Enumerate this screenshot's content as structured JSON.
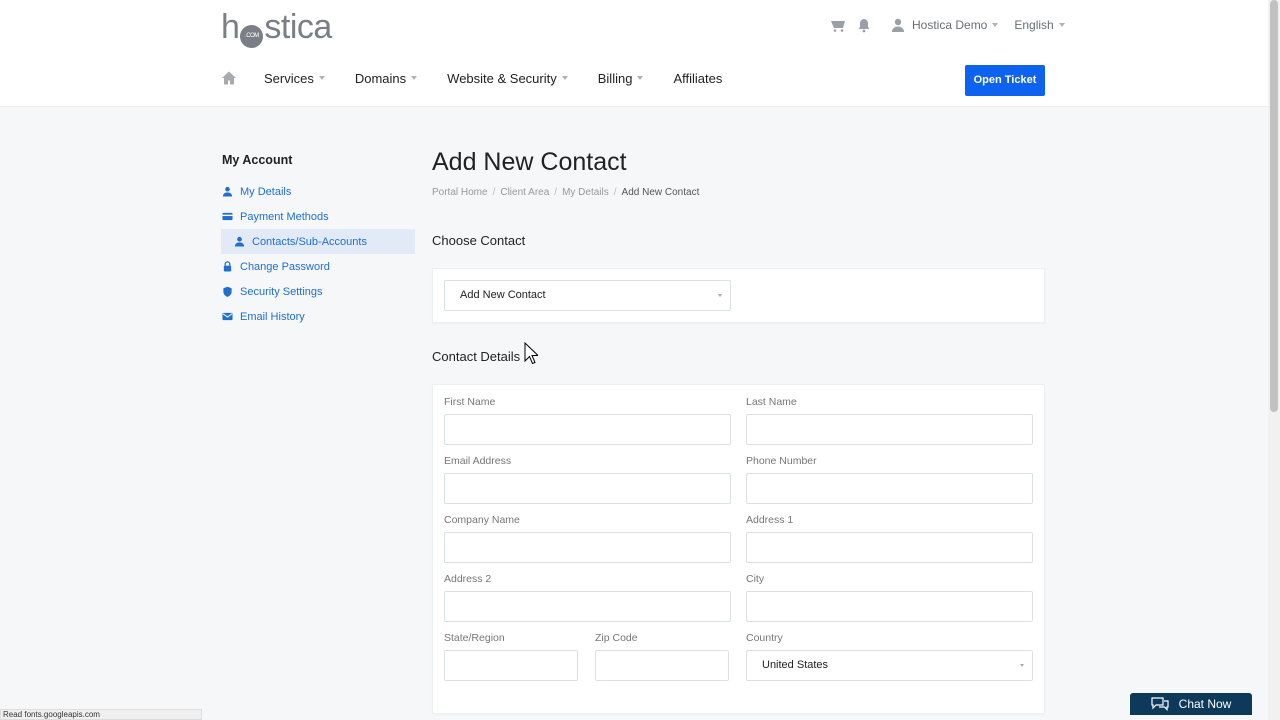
{
  "brand": {
    "logo_pre": "h",
    "logo_badge": ".COM",
    "logo_post": "stica"
  },
  "topbar": {
    "user": "Hostica Demo",
    "language": "English",
    "icons": [
      "cart-icon",
      "bell-icon",
      "user-icon"
    ]
  },
  "nav": {
    "home_icon": "home-icon",
    "items": [
      {
        "label": "Services",
        "dropdown": true
      },
      {
        "label": "Domains",
        "dropdown": true
      },
      {
        "label": "Website & Security",
        "dropdown": true
      },
      {
        "label": "Billing",
        "dropdown": true
      },
      {
        "label": "Affiliates",
        "dropdown": false
      }
    ],
    "cta": "Open Ticket"
  },
  "sidebar": {
    "title": "My Account",
    "items": [
      {
        "label": "My Details",
        "icon": "user-icon"
      },
      {
        "label": "Payment Methods",
        "icon": "card-icon"
      },
      {
        "label": "Contacts/Sub-Accounts",
        "icon": "user-icon",
        "active": true
      },
      {
        "label": "Change Password",
        "icon": "lock-icon"
      },
      {
        "label": "Security Settings",
        "icon": "shield-icon"
      },
      {
        "label": "Email History",
        "icon": "mail-icon"
      }
    ]
  },
  "main": {
    "title": "Add New Contact",
    "breadcrumb": [
      "Portal Home",
      "Client Area",
      "My Details",
      "Add New Contact"
    ],
    "choose_contact": {
      "heading": "Choose Contact",
      "selected": "Add New Contact"
    },
    "contact_details": {
      "heading": "Contact Details",
      "fields": {
        "first_name": "First Name",
        "last_name": "Last Name",
        "email": "Email Address",
        "phone": "Phone Number",
        "company": "Company Name",
        "address1": "Address 1",
        "address2": "Address 2",
        "city": "City",
        "state": "State/Region",
        "zip": "Zip Code",
        "country": "Country"
      },
      "country_value": "United States"
    }
  },
  "chat": {
    "label": "Chat Now"
  },
  "statusbar": {
    "text": "Read fonts.googleapis.com"
  },
  "colors": {
    "accent": "#0d62f0",
    "link": "#1f6fd0",
    "chat": "#0d3a5a"
  }
}
